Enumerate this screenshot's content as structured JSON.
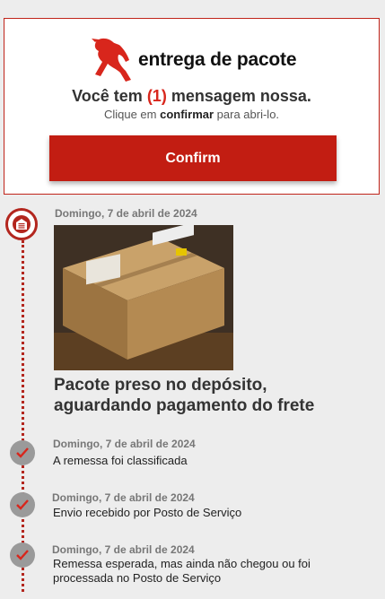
{
  "header": {
    "brand_name": "entrega de pacote",
    "message_prefix": "Você tem ",
    "message_count": "(1)",
    "message_suffix": " mensagem nossa.",
    "instruction_prefix": "Clique em ",
    "instruction_keyword": "confirmar",
    "instruction_suffix": " para abri-lo.",
    "confirm_label": "Confirm"
  },
  "main_event": {
    "date": "Domingo, 7 de abril de 2024",
    "title_line1": "Pacote preso no depósito,",
    "title_line2": "aguardando pagamento do frete"
  },
  "events": [
    {
      "date": "Domingo, 7 de abril de 2024",
      "text": "A remessa foi classificada"
    },
    {
      "date": "Domingo, 7 de abril de 2024",
      "text": "Envio recebido por Posto de Serviço"
    },
    {
      "date": "Domingo, 7 de abril de 2024",
      "text_line1": "Remessa esperada, mas ainda não chegou ou foi",
      "text_line2": "processada no Posto de Serviço"
    }
  ],
  "colors": {
    "accent": "#c21d12",
    "rail": "#b3261e",
    "check": "#9a9a9a"
  },
  "icons": {
    "logo": "horse-logo-icon",
    "hub": "warehouse-icon",
    "event": "check-icon"
  }
}
